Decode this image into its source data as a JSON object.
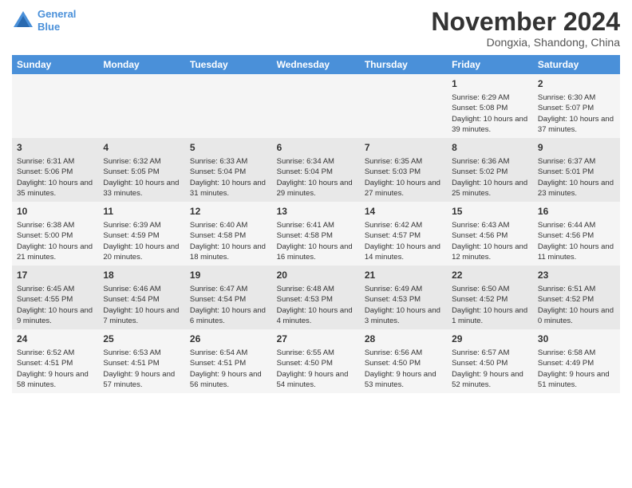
{
  "header": {
    "logo_line1": "General",
    "logo_line2": "Blue",
    "month_title": "November 2024",
    "location": "Dongxia, Shandong, China"
  },
  "columns": [
    "Sunday",
    "Monday",
    "Tuesday",
    "Wednesday",
    "Thursday",
    "Friday",
    "Saturday"
  ],
  "weeks": [
    {
      "days": [
        {
          "num": "",
          "data": ""
        },
        {
          "num": "",
          "data": ""
        },
        {
          "num": "",
          "data": ""
        },
        {
          "num": "",
          "data": ""
        },
        {
          "num": "",
          "data": ""
        },
        {
          "num": "1",
          "data": "Sunrise: 6:29 AM\nSunset: 5:08 PM\nDaylight: 10 hours and 39 minutes."
        },
        {
          "num": "2",
          "data": "Sunrise: 6:30 AM\nSunset: 5:07 PM\nDaylight: 10 hours and 37 minutes."
        }
      ]
    },
    {
      "days": [
        {
          "num": "3",
          "data": "Sunrise: 6:31 AM\nSunset: 5:06 PM\nDaylight: 10 hours and 35 minutes."
        },
        {
          "num": "4",
          "data": "Sunrise: 6:32 AM\nSunset: 5:05 PM\nDaylight: 10 hours and 33 minutes."
        },
        {
          "num": "5",
          "data": "Sunrise: 6:33 AM\nSunset: 5:04 PM\nDaylight: 10 hours and 31 minutes."
        },
        {
          "num": "6",
          "data": "Sunrise: 6:34 AM\nSunset: 5:04 PM\nDaylight: 10 hours and 29 minutes."
        },
        {
          "num": "7",
          "data": "Sunrise: 6:35 AM\nSunset: 5:03 PM\nDaylight: 10 hours and 27 minutes."
        },
        {
          "num": "8",
          "data": "Sunrise: 6:36 AM\nSunset: 5:02 PM\nDaylight: 10 hours and 25 minutes."
        },
        {
          "num": "9",
          "data": "Sunrise: 6:37 AM\nSunset: 5:01 PM\nDaylight: 10 hours and 23 minutes."
        }
      ]
    },
    {
      "days": [
        {
          "num": "10",
          "data": "Sunrise: 6:38 AM\nSunset: 5:00 PM\nDaylight: 10 hours and 21 minutes."
        },
        {
          "num": "11",
          "data": "Sunrise: 6:39 AM\nSunset: 4:59 PM\nDaylight: 10 hours and 20 minutes."
        },
        {
          "num": "12",
          "data": "Sunrise: 6:40 AM\nSunset: 4:58 PM\nDaylight: 10 hours and 18 minutes."
        },
        {
          "num": "13",
          "data": "Sunrise: 6:41 AM\nSunset: 4:58 PM\nDaylight: 10 hours and 16 minutes."
        },
        {
          "num": "14",
          "data": "Sunrise: 6:42 AM\nSunset: 4:57 PM\nDaylight: 10 hours and 14 minutes."
        },
        {
          "num": "15",
          "data": "Sunrise: 6:43 AM\nSunset: 4:56 PM\nDaylight: 10 hours and 12 minutes."
        },
        {
          "num": "16",
          "data": "Sunrise: 6:44 AM\nSunset: 4:56 PM\nDaylight: 10 hours and 11 minutes."
        }
      ]
    },
    {
      "days": [
        {
          "num": "17",
          "data": "Sunrise: 6:45 AM\nSunset: 4:55 PM\nDaylight: 10 hours and 9 minutes."
        },
        {
          "num": "18",
          "data": "Sunrise: 6:46 AM\nSunset: 4:54 PM\nDaylight: 10 hours and 7 minutes."
        },
        {
          "num": "19",
          "data": "Sunrise: 6:47 AM\nSunset: 4:54 PM\nDaylight: 10 hours and 6 minutes."
        },
        {
          "num": "20",
          "data": "Sunrise: 6:48 AM\nSunset: 4:53 PM\nDaylight: 10 hours and 4 minutes."
        },
        {
          "num": "21",
          "data": "Sunrise: 6:49 AM\nSunset: 4:53 PM\nDaylight: 10 hours and 3 minutes."
        },
        {
          "num": "22",
          "data": "Sunrise: 6:50 AM\nSunset: 4:52 PM\nDaylight: 10 hours and 1 minute."
        },
        {
          "num": "23",
          "data": "Sunrise: 6:51 AM\nSunset: 4:52 PM\nDaylight: 10 hours and 0 minutes."
        }
      ]
    },
    {
      "days": [
        {
          "num": "24",
          "data": "Sunrise: 6:52 AM\nSunset: 4:51 PM\nDaylight: 9 hours and 58 minutes."
        },
        {
          "num": "25",
          "data": "Sunrise: 6:53 AM\nSunset: 4:51 PM\nDaylight: 9 hours and 57 minutes."
        },
        {
          "num": "26",
          "data": "Sunrise: 6:54 AM\nSunset: 4:51 PM\nDaylight: 9 hours and 56 minutes."
        },
        {
          "num": "27",
          "data": "Sunrise: 6:55 AM\nSunset: 4:50 PM\nDaylight: 9 hours and 54 minutes."
        },
        {
          "num": "28",
          "data": "Sunrise: 6:56 AM\nSunset: 4:50 PM\nDaylight: 9 hours and 53 minutes."
        },
        {
          "num": "29",
          "data": "Sunrise: 6:57 AM\nSunset: 4:50 PM\nDaylight: 9 hours and 52 minutes."
        },
        {
          "num": "30",
          "data": "Sunrise: 6:58 AM\nSunset: 4:49 PM\nDaylight: 9 hours and 51 minutes."
        }
      ]
    }
  ]
}
